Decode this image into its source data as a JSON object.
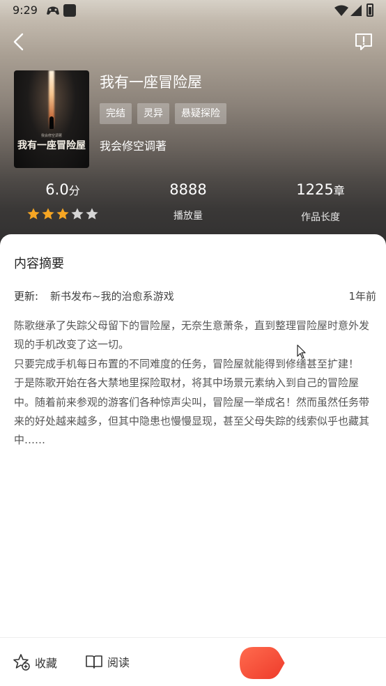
{
  "status_bar": {
    "time": "9:29"
  },
  "header": {
    "back_icon": "chevron-left-icon",
    "report_icon": "report-icon"
  },
  "book": {
    "cover": {
      "title": "我有一座冒险屋",
      "subtitle": "我会修空调著"
    },
    "title": "我有一座冒险屋",
    "tags": [
      "完结",
      "灵异",
      "悬疑探险"
    ],
    "author": "我会修空调著"
  },
  "stats": {
    "rating": {
      "value": "6.0",
      "unit": "分",
      "stars_filled": 3,
      "stars_total": 5
    },
    "plays": {
      "value": "8888",
      "label": "播放量"
    },
    "length": {
      "value": "1225",
      "unit": "章",
      "label": "作品长度"
    }
  },
  "summary_section": {
    "title": "内容摘要",
    "update_label": "更新:",
    "update_text": "新书发布~我的治愈系游戏",
    "update_time": "1年前",
    "paragraphs": [
      "陈歌继承了失踪父母留下的冒险屋，无奈生意萧条，直到整理冒险屋时意外发现的手机改变了这一切。",
      "只要完成手机每日布置的不同难度的任务，冒险屋就能得到修缮甚至扩建！",
      "于是陈歌开始在各大禁地里探险取材，将其中场景元素纳入到自己的冒险屋中。随着前来参观的游客们各种惊声尖叫，冒险屋一举成名！然而虽然任务带来的好处越来越多，但其中隐患也慢慢显现，甚至父母失踪的线索似乎也藏其中……"
    ]
  },
  "bottom_bar": {
    "collect_label": "收藏",
    "read_label": "阅读"
  },
  "colors": {
    "star_filled": "#f6a623",
    "star_empty": "#d6d6d6",
    "play_button": "#f44a34"
  }
}
